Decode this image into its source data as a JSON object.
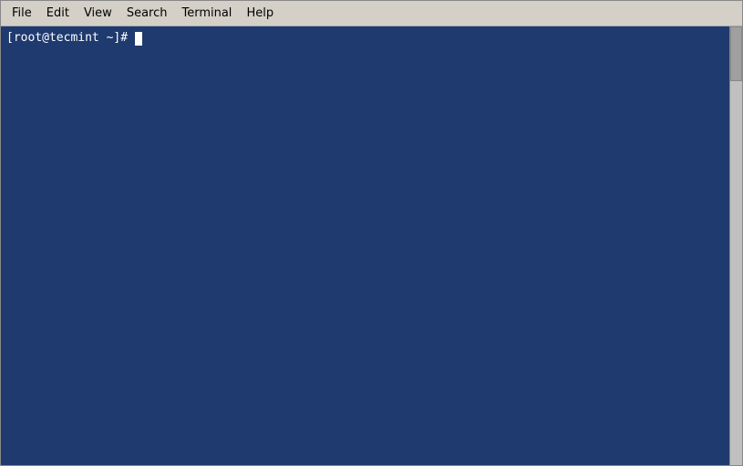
{
  "menubar": {
    "items": [
      {
        "id": "file",
        "label": "File"
      },
      {
        "id": "edit",
        "label": "Edit"
      },
      {
        "id": "view",
        "label": "View"
      },
      {
        "id": "search",
        "label": "Search"
      },
      {
        "id": "terminal",
        "label": "Terminal"
      },
      {
        "id": "help",
        "label": "Help"
      }
    ]
  },
  "terminal": {
    "prompt": "[root@tecmint ~]# ",
    "bg_color": "#1e3a6e"
  }
}
